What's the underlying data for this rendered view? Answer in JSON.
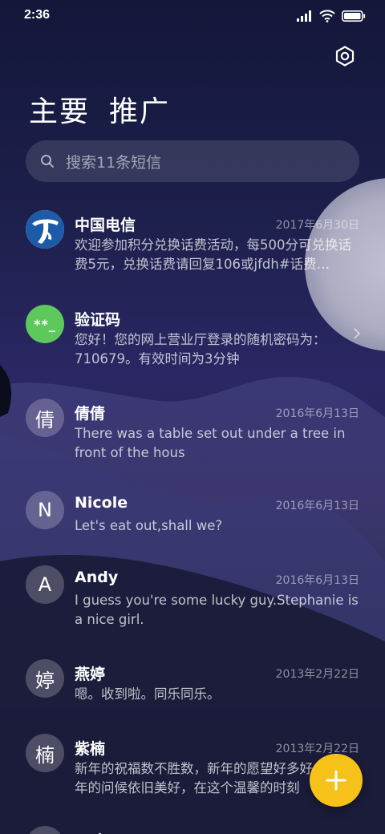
{
  "status_bar": {
    "time": "2:36"
  },
  "header": {
    "tabs": [
      "主要",
      "推广"
    ]
  },
  "search": {
    "placeholder": "搜索11条短信"
  },
  "conversations": [
    {
      "name": "中国电信",
      "date": "2017年6月30日",
      "preview": "欢迎参加积分兑换话费活动，每500分可兑换话费5元，兑换话费请回复106或jfdh#话费…",
      "avatar": "china-telecom-logo"
    },
    {
      "name": "验证码",
      "date": "",
      "preview": "您好！您的网上营业厅登录的随机密码为：710679。有效时间为3分钟",
      "avatar_text": "**_"
    },
    {
      "name": "倩倩",
      "date": "2016年6月13日",
      "preview": "There was a table set out under a tree in front of the hous",
      "avatar_text": "倩"
    },
    {
      "name": "Nicole",
      "date": "2016年6月13日",
      "preview": "Let's eat out,shall we?",
      "avatar_text": "N"
    },
    {
      "name": "Andy",
      "date": "2016年6月13日",
      "preview": "I guess you're some lucky guy.Stephanie is a nice girl.",
      "avatar_text": "A"
    },
    {
      "name": "燕婷",
      "date": "2013年2月22日",
      "preview": "嗯。收到啦。同乐同乐。",
      "avatar_text": "婷"
    },
    {
      "name": "紫楠",
      "date": "2013年2月22日",
      "preview": "新年的祝福数不胜数，新年的愿望好多好多，新年的问候依旧美好，在这个温馨的时刻",
      "avatar_text": "楠"
    },
    {
      "name": "子玲",
      "date": "",
      "preview": "",
      "avatar_text": "玲"
    }
  ],
  "colors": {
    "fab": "#f6c21a",
    "verify_avatar": "#5dc85b",
    "telecom_blue": "#1d5aa8"
  },
  "icons": {
    "settings": "gear-icon",
    "search": "search-icon",
    "fab": "plus-icon",
    "chevron": "chevron-right-icon"
  }
}
